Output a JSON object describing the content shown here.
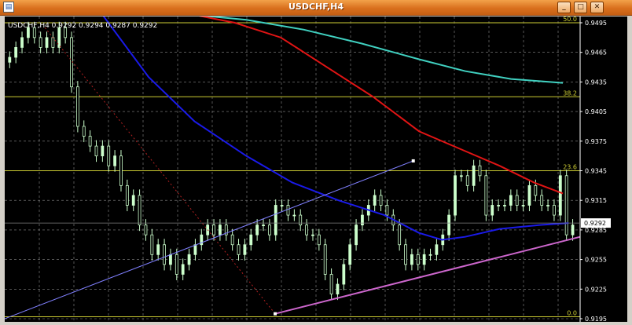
{
  "window": {
    "title": "USDCHF,H4",
    "icon": "chart-window-icon",
    "buttons": [
      {
        "name": "minimize-button",
        "glyph": "_"
      },
      {
        "name": "maximize-button",
        "glyph": "□"
      },
      {
        "name": "close-button",
        "glyph": "✕"
      }
    ]
  },
  "chart_info": "USDCHF,H4  0.9292 0.9294 0.9287 0.9292",
  "current_price_label": "0.9292",
  "colors": {
    "background": "#000000",
    "grid": "#8a8a8a",
    "bull_candle": "#ccffcc",
    "ma_fast": "#1a1ae8",
    "ma_mid": "#e01414",
    "ma_slow": "#40d0c0",
    "fibo": "#cccc33",
    "trend_upper": "#8080ff",
    "trend_lower": "#cc66cc",
    "fibo_diag": "#b02020"
  },
  "chart_data": {
    "type": "candlestick",
    "y_axis": {
      "min": 0.9195,
      "max": 0.9495,
      "ticks": [
        "0.9495",
        "0.9465",
        "0.9435",
        "0.9405",
        "0.9375",
        "0.9345",
        "0.9315",
        "0.9285",
        "0.9255",
        "0.9225",
        "0.9195"
      ]
    },
    "fibo_levels": [
      {
        "label": "50.0",
        "value": 0.9495
      },
      {
        "label": "38.2",
        "value": 0.942
      },
      {
        "label": "23.6",
        "value": 0.9345
      },
      {
        "label": "0.0",
        "value": 0.9197
      }
    ],
    "current_price": 0.9292,
    "closes": [
      0.946,
      0.947,
      0.948,
      0.949,
      0.948,
      0.947,
      0.948,
      0.947,
      0.949,
      0.948,
      0.943,
      0.939,
      0.938,
      0.937,
      0.936,
      0.937,
      0.935,
      0.936,
      0.933,
      0.931,
      0.932,
      0.929,
      0.928,
      0.926,
      0.927,
      0.925,
      0.926,
      0.924,
      0.925,
      0.926,
      0.927,
      0.928,
      0.929,
      0.928,
      0.929,
      0.928,
      0.927,
      0.926,
      0.927,
      0.928,
      0.929,
      0.929,
      0.928,
      0.931,
      0.931,
      0.93,
      0.93,
      0.929,
      0.928,
      0.928,
      0.927,
      0.924,
      0.922,
      0.923,
      0.925,
      0.927,
      0.929,
      0.93,
      0.931,
      0.932,
      0.931,
      0.93,
      0.929,
      0.927,
      0.925,
      0.926,
      0.925,
      0.926,
      0.926,
      0.927,
      0.928,
      0.93,
      0.934,
      0.934,
      0.933,
      0.935,
      0.934,
      0.93,
      0.931,
      0.931,
      0.931,
      0.932,
      0.931,
      0.931,
      0.933,
      0.932,
      0.931,
      0.931,
      0.93,
      0.934,
      0.928,
      0.929
    ],
    "ma_fast": [
      [
        0.17,
        0.9503
      ],
      [
        0.25,
        0.944
      ],
      [
        0.33,
        0.9395
      ],
      [
        0.42,
        0.936
      ],
      [
        0.5,
        0.9333
      ],
      [
        0.58,
        0.9315
      ],
      [
        0.66,
        0.93
      ],
      [
        0.72,
        0.9282
      ],
      [
        0.76,
        0.9275
      ],
      [
        0.8,
        0.9278
      ],
      [
        0.86,
        0.9286
      ],
      [
        0.93,
        0.929
      ],
      [
        0.98,
        0.9292
      ]
    ],
    "ma_mid": [
      [
        0.33,
        0.9503
      ],
      [
        0.4,
        0.9495
      ],
      [
        0.48,
        0.948
      ],
      [
        0.56,
        0.945
      ],
      [
        0.64,
        0.942
      ],
      [
        0.72,
        0.9385
      ],
      [
        0.8,
        0.9365
      ],
      [
        0.86,
        0.935
      ],
      [
        0.92,
        0.9333
      ],
      [
        0.97,
        0.9322
      ]
    ],
    "ma_slow": [
      [
        0.33,
        0.9503
      ],
      [
        0.42,
        0.9498
      ],
      [
        0.52,
        0.9488
      ],
      [
        0.62,
        0.9474
      ],
      [
        0.72,
        0.9458
      ],
      [
        0.8,
        0.9446
      ],
      [
        0.88,
        0.9438
      ],
      [
        0.97,
        0.9434
      ]
    ],
    "trend_upper": [
      [
        0.0,
        0.9195
      ],
      [
        0.71,
        0.9355
      ]
    ],
    "trend_lower": [
      [
        0.47,
        0.92
      ],
      [
        1.0,
        0.9278
      ]
    ],
    "fibo_diag": [
      [
        0.07,
        0.949
      ],
      [
        0.47,
        0.92
      ]
    ]
  }
}
